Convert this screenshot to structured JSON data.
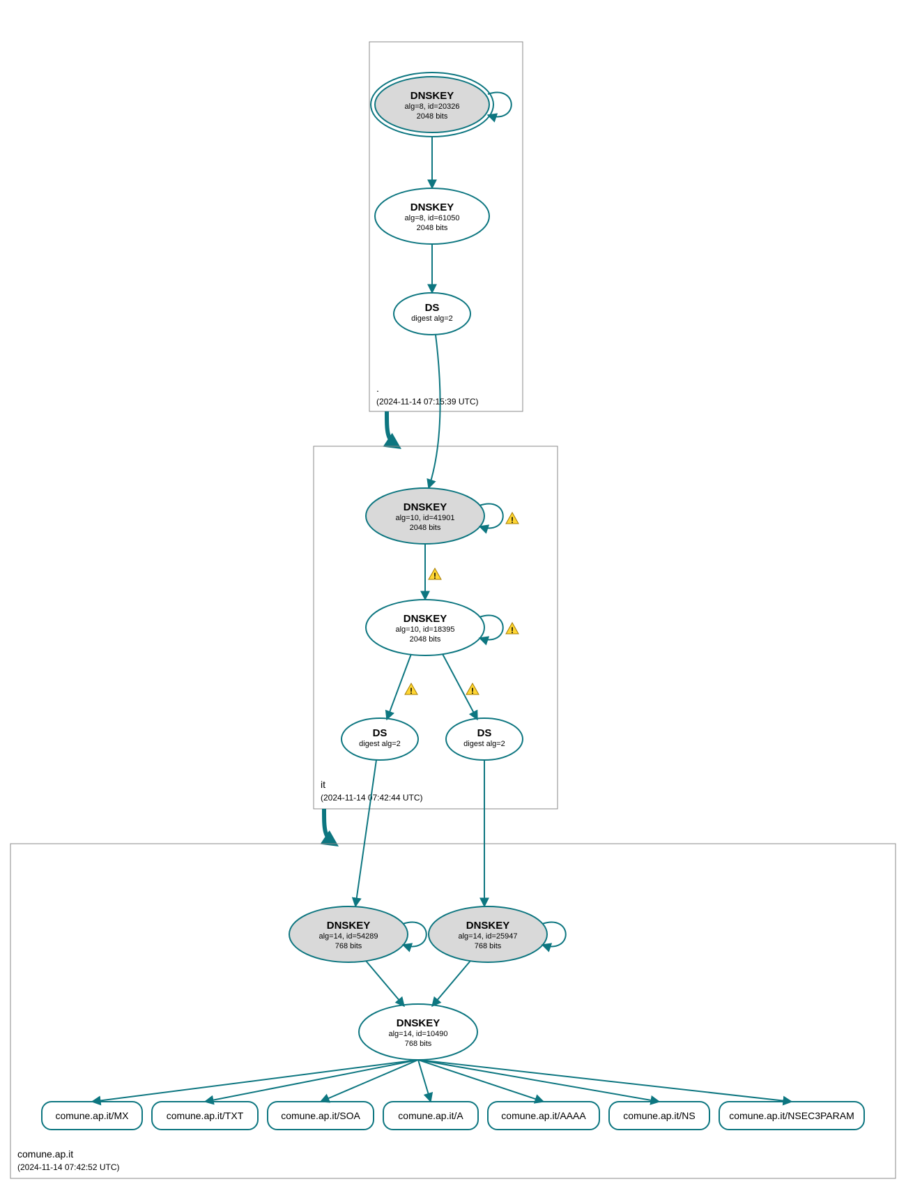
{
  "zones": {
    "root": {
      "label": ".",
      "timestamp": "(2024-11-14 07:15:39 UTC)"
    },
    "it": {
      "label": "it",
      "timestamp": "(2024-11-14 07:42:44 UTC)"
    },
    "leaf": {
      "label": "comune.ap.it",
      "timestamp": "(2024-11-14 07:42:52 UTC)"
    }
  },
  "nodes": {
    "root_ksk": {
      "title": "DNSKEY",
      "line1": "alg=8, id=20326",
      "line2": "2048 bits"
    },
    "root_zsk": {
      "title": "DNSKEY",
      "line1": "alg=8, id=61050",
      "line2": "2048 bits"
    },
    "root_ds": {
      "title": "DS",
      "line1": "digest alg=2"
    },
    "it_ksk": {
      "title": "DNSKEY",
      "line1": "alg=10, id=41901",
      "line2": "2048 bits"
    },
    "it_zsk": {
      "title": "DNSKEY",
      "line1": "alg=10, id=18395",
      "line2": "2048 bits"
    },
    "it_ds1": {
      "title": "DS",
      "line1": "digest alg=2"
    },
    "it_ds2": {
      "title": "DS",
      "line1": "digest alg=2"
    },
    "leaf_ksk1": {
      "title": "DNSKEY",
      "line1": "alg=14, id=54289",
      "line2": "768 bits"
    },
    "leaf_ksk2": {
      "title": "DNSKEY",
      "line1": "alg=14, id=25947",
      "line2": "768 bits"
    },
    "leaf_zsk": {
      "title": "DNSKEY",
      "line1": "alg=14, id=10490",
      "line2": "768 bits"
    }
  },
  "rrsets": [
    "comune.ap.it/MX",
    "comune.ap.it/TXT",
    "comune.ap.it/SOA",
    "comune.ap.it/A",
    "comune.ap.it/AAAA",
    "comune.ap.it/NS",
    "comune.ap.it/NSEC3PARAM"
  ]
}
